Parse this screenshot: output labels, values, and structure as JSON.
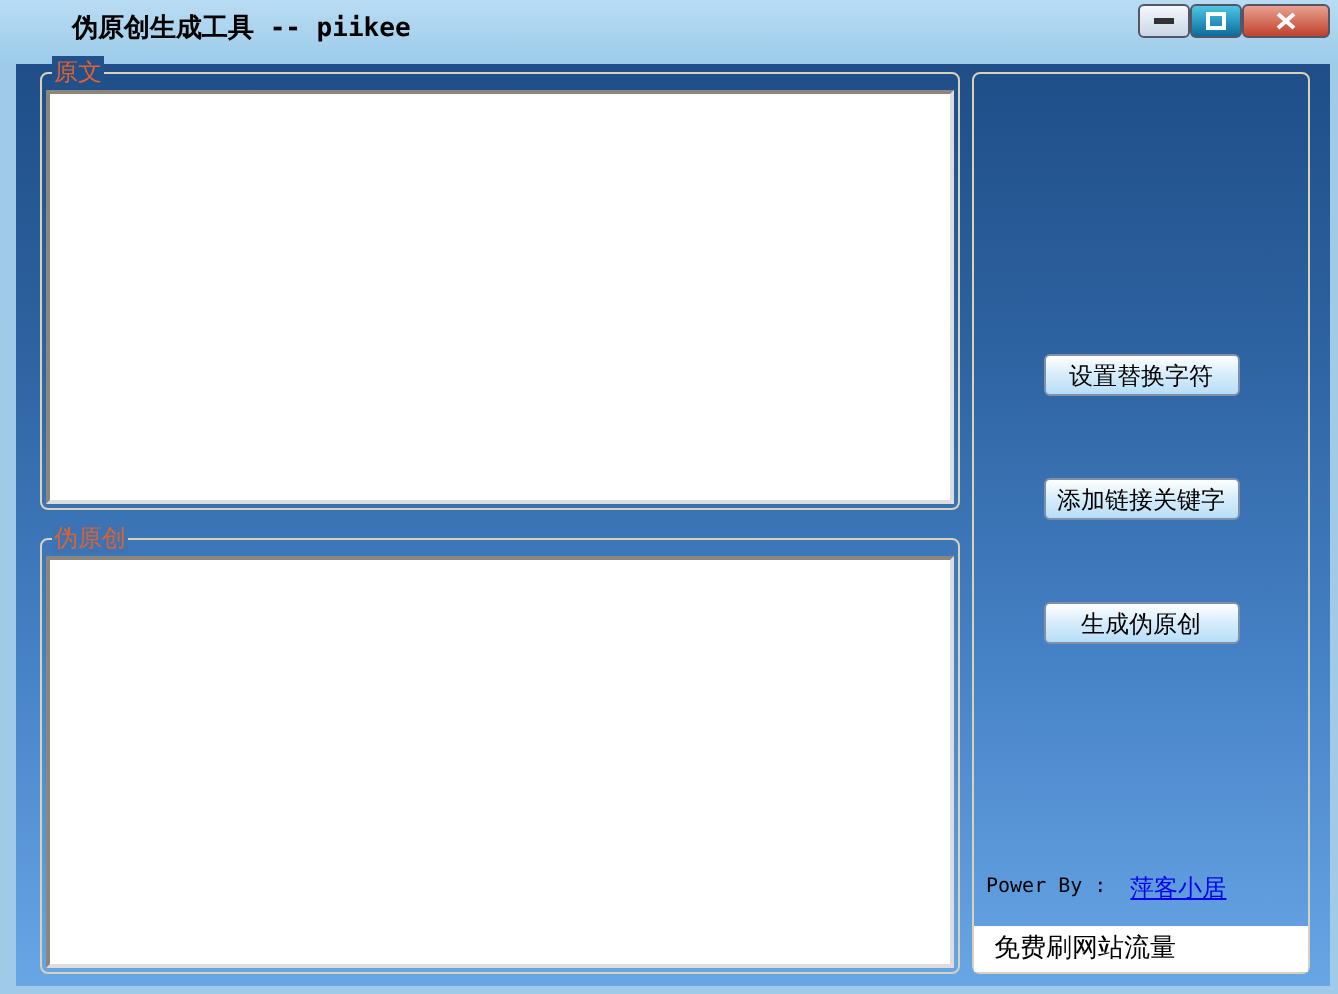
{
  "window": {
    "title": "伪原创生成工具 -- piikee"
  },
  "groups": [
    {
      "label": "原文"
    },
    {
      "label": "伪原创"
    }
  ],
  "buttons": [
    "设置替换字符",
    "添加链接关键字",
    "生成伪原创"
  ],
  "footer": {
    "label": "Power By :",
    "link": "萍客小居"
  },
  "banner": {
    "text": "免费刷网站流量"
  }
}
